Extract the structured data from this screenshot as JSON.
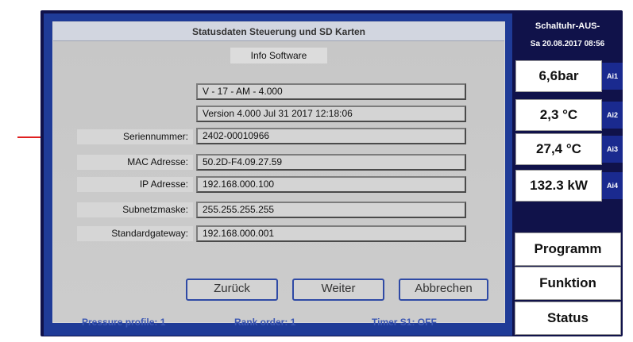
{
  "panel": {
    "title": "Statusdaten Steuerung und SD Karten",
    "section_label": "Info Software"
  },
  "software": {
    "version_short": "V - 17 -  AM - 4.000",
    "version_full": "Version 4.000 Jul 31 2017 12:18:06"
  },
  "fields": [
    {
      "label": "Seriennummer:",
      "value": "2402-00010966"
    },
    {
      "label": "MAC Adresse:",
      "value": "50.2D-F4.09.27.59"
    },
    {
      "label": "IP Adresse:",
      "value": "192.168.000.100"
    },
    {
      "label": "Subnetzmaske:",
      "value": "255.255.255.255"
    },
    {
      "label": "Standardgateway:",
      "value": "192.168.000.001"
    }
  ],
  "buttons": {
    "back": "Zurück",
    "next": "Weiter",
    "cancel": "Abbrechen"
  },
  "status_bar": {
    "pressure": "Pressure profile: 1",
    "rank": "Rank order: 1",
    "timer": "Timer S1: OFF"
  },
  "sidebar": {
    "clock_title": "Schaltuhr-AUS-",
    "datetime": "Sa 20.08.2017 08:56",
    "readings": [
      {
        "value": "6,6bar",
        "tag": "Ai1"
      },
      {
        "value": "2,3 °C",
        "tag": "Ai2"
      },
      {
        "value": "27,4 °C",
        "tag": "Ai3"
      },
      {
        "value": "132.3 kW",
        "tag": "Ai4"
      }
    ],
    "menu": [
      "Programm",
      "Funktion",
      "Status"
    ]
  },
  "colors": {
    "annotation_arrow": "#e02020",
    "frame": "#1f3b97",
    "button_border": "#2f4aa5"
  }
}
